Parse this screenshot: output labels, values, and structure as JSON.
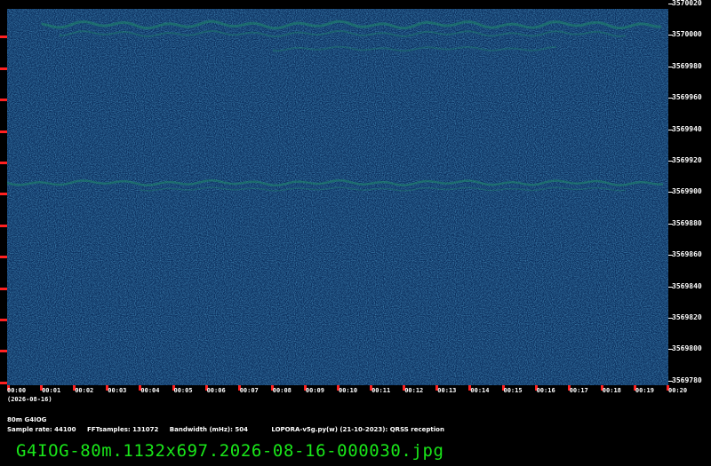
{
  "station": "80m G4IOG",
  "info": {
    "sample_rate": "Sample rate: 44100",
    "fft_samples": "FFTsamples: 131072",
    "bandwidth": "Bandwidth (mHz): 504",
    "program": "LOPORA-v5g.py(w) (21-10-2023): QRSS reception"
  },
  "date": "(2026-08-16)",
  "filename": "G4IOG-80m.1132x697.2026-08-16-000030.jpg",
  "freq_axis": [
    "3570020",
    "3570000",
    "3569980",
    "3569960",
    "3569940",
    "3569920",
    "3569900",
    "3569880",
    "3569860",
    "3569840",
    "3569820",
    "3569800",
    "3569780"
  ],
  "time_axis": [
    "00:00",
    "00:01",
    "00:02",
    "00:03",
    "00:04",
    "00:05",
    "00:06",
    "00:07",
    "00:08",
    "00:09",
    "00:10",
    "00:11",
    "00:12",
    "00:13",
    "00:14",
    "00:15",
    "00:16",
    "00:17",
    "00:18",
    "00:19",
    "00:20"
  ],
  "colors": {
    "background": "#0b2f5e",
    "signal": "#1f8a6a",
    "tick": "#ff2020",
    "filename_text": "#19e619"
  }
}
